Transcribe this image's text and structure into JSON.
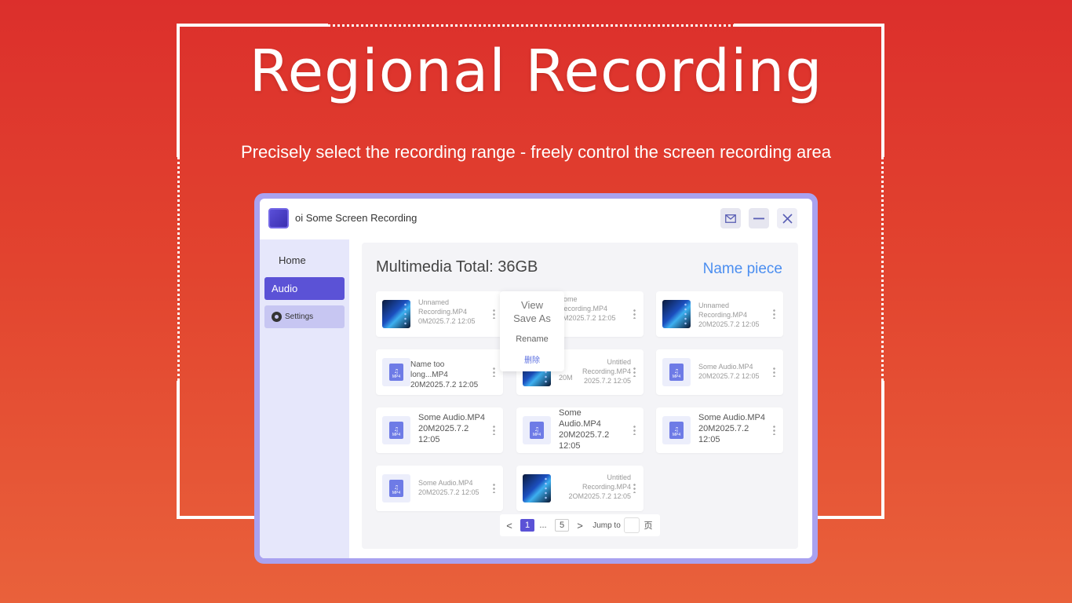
{
  "hero": {
    "title": "Regional Recording",
    "subtitle": "Precisely select the recording range - freely control the screen recording area"
  },
  "window": {
    "title": "oi Some Screen Recording",
    "buttons": [
      "mail-icon",
      "minimize-icon",
      "close-icon"
    ]
  },
  "sidebar": {
    "items": [
      {
        "label": "Home",
        "active": false
      },
      {
        "label": "Audio",
        "active": true
      },
      {
        "label": "Settings",
        "active": false,
        "icon": "gear-icon"
      }
    ]
  },
  "main": {
    "total_label": "Multimedia Total: 36GB",
    "name_piece": "Name piece"
  },
  "cards": [
    {
      "type": "video",
      "text": [
        "Unnamed",
        "Recording.MP4",
        "0M2025.7.2 12:05"
      ]
    },
    {
      "type": "video",
      "text": [
        "Some",
        "Recording.MP4",
        "0M2025.7.2 12:05"
      ]
    },
    {
      "type": "video",
      "text": [
        "Unnamed",
        "Recording.MP4",
        "20M2025.7.2 12:05"
      ]
    },
    {
      "type": "audio",
      "text": [
        "Name too long...MP4",
        "20M2025.7.2 12:05"
      ]
    },
    {
      "type": "video",
      "text": [
        "Untitled",
        "Recording.MP4",
        "2025.7.2 12:05"
      ],
      "partial": "20M"
    },
    {
      "type": "audio",
      "text": [
        "Some Audio.MP4",
        "20M2025.7.2 12:05"
      ]
    },
    {
      "type": "audio",
      "text": [
        "Some Audio.MP4",
        "20M2025.7.2",
        "12:05"
      ]
    },
    {
      "type": "audio",
      "text": [
        "Some",
        "Audio.MP4",
        "20M2025.7.2",
        "12:05"
      ]
    },
    {
      "type": "audio",
      "text": [
        "Some Audio.MP4",
        "20M2025.7.2",
        "12:05"
      ]
    },
    {
      "type": "audio",
      "text": [
        "Some Audio.MP4",
        "20M2025.7.2 12:05"
      ]
    },
    {
      "type": "video",
      "text": [
        "Untitled",
        "Recording.MP4",
        "2OM2025.7.2 12:05"
      ]
    }
  ],
  "context_menu": {
    "items": [
      "View",
      "Save As",
      "Rename",
      "删除"
    ]
  },
  "pagination": {
    "prev": "<",
    "current": "1",
    "ellipsis": "...",
    "last": "5",
    "next": ">",
    "jump_label": "Jump to",
    "unit": "页"
  },
  "icons": {
    "mp4_label": "MP4",
    "note": "♫"
  },
  "colors": {
    "accent": "#5b52d6",
    "link": "#4b8ef0",
    "background_top": "#dc2f2c",
    "background_bottom": "#e9613b"
  }
}
